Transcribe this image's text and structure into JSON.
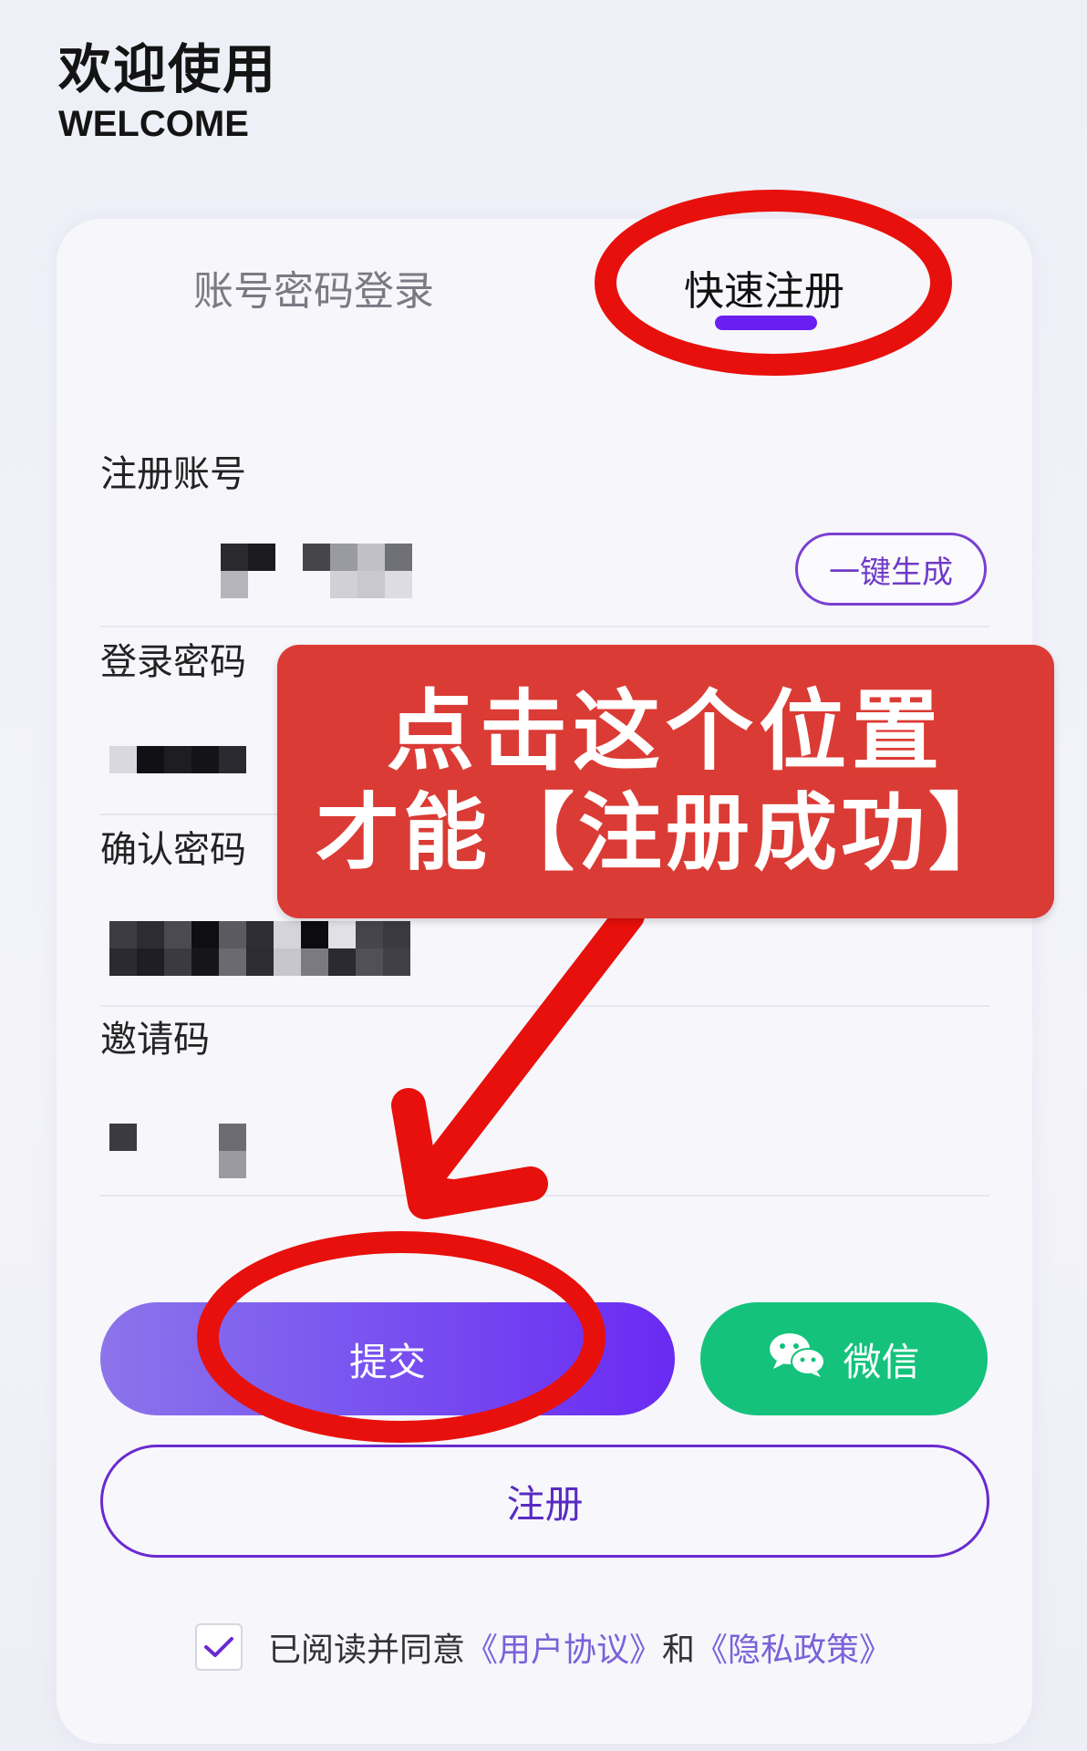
{
  "header": {
    "title": "欢迎使用",
    "subtitle": "WELCOME"
  },
  "tabs": {
    "login": "账号密码登录",
    "register": "快速注册"
  },
  "form": {
    "account_label": "注册账号",
    "generate_button": "一键生成",
    "password_label": "登录密码",
    "confirm_label": "确认密码",
    "invite_label": "邀请码"
  },
  "actions": {
    "submit": "提交",
    "wechat": "微信",
    "register": "注册"
  },
  "agreement": {
    "prefix": "已阅读并同意",
    "user_agreement": "《用户协议》",
    "and": "和",
    "privacy_policy": "《隐私政策》",
    "checked": true
  },
  "annotation": {
    "line1": "点击这个位置",
    "line2": "才能【注册成功】"
  },
  "colors": {
    "accent": "#6a1ff0",
    "wechat_green": "#14c27c",
    "annotation_red": "#e8100c",
    "annotation_box": "#db3b35"
  }
}
